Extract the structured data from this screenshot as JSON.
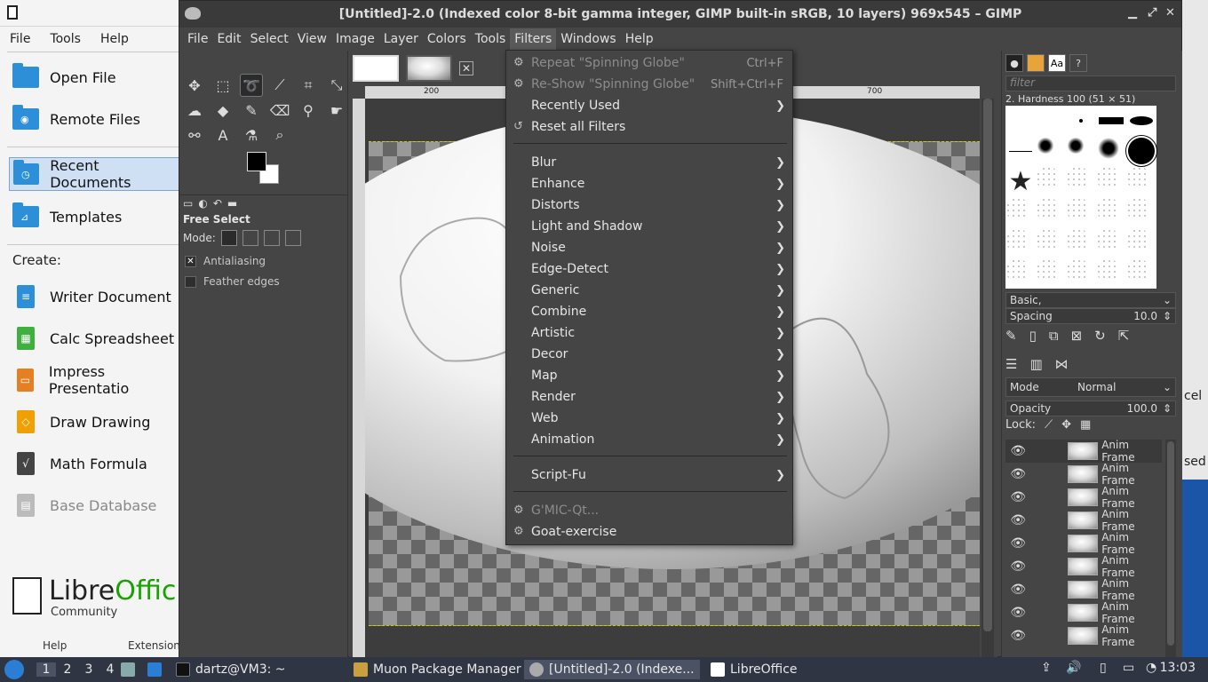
{
  "libreoffice": {
    "menu": [
      "File",
      "Tools",
      "Help"
    ],
    "nav": [
      {
        "label": "Open File",
        "icon": "open-folder-icon"
      },
      {
        "label": "Remote Files",
        "icon": "remote-folder-icon"
      },
      {
        "label": "Recent Documents",
        "icon": "recent-folder-icon"
      },
      {
        "label": "Templates",
        "icon": "templates-folder-icon"
      }
    ],
    "create_label": "Create:",
    "create": [
      {
        "label": "Writer Document",
        "color": "#2d8fd8"
      },
      {
        "label": "Calc Spreadsheet",
        "color": "#3faf3f"
      },
      {
        "label": "Impress Presentatio",
        "color": "#e67e22"
      },
      {
        "label": "Draw Drawing",
        "color": "#f0a000"
      },
      {
        "label": "Math Formula",
        "color": "#444444"
      },
      {
        "label": "Base Database",
        "color": "#aaaaaa"
      }
    ],
    "brand_a": "Libre",
    "brand_b": "Offic",
    "brand_sub": "Community",
    "footer_help": "Help",
    "footer_ext": "Extension"
  },
  "gimp": {
    "title": "[Untitled]-2.0 (Indexed color 8-bit gamma integer, GIMP built-in sRGB, 10 layers) 969x545 – GIMP",
    "menu": [
      "File",
      "Edit",
      "Select",
      "View",
      "Image",
      "Layer",
      "Colors",
      "Tools",
      "Filters",
      "Windows",
      "Help"
    ],
    "open_menu": "Filters",
    "tool_options": {
      "title": "Free Select",
      "mode_label": "Mode:",
      "antialiasing": "Antialiasing",
      "feather": "Feather edges"
    },
    "ruler": {
      "mark_200": "200",
      "mark_700": "700"
    },
    "filters_menu": {
      "top": [
        {
          "label": "Repeat \"Spinning Globe\"",
          "accel": "Ctrl+F",
          "disabled": true
        },
        {
          "label": "Re-Show \"Spinning Globe\"",
          "accel": "Shift+Ctrl+F",
          "disabled": true
        },
        {
          "label": "Recently Used",
          "submenu": true
        },
        {
          "label": "Reset all Filters"
        }
      ],
      "groups": [
        "Blur",
        "Enhance",
        "Distorts",
        "Light and Shadow",
        "Noise",
        "Edge-Detect",
        "Generic",
        "Combine",
        "Artistic",
        "Decor",
        "Map",
        "Render",
        "Web",
        "Animation"
      ],
      "script": "Script-Fu",
      "gmic": "G'MIC-Qt...",
      "goat": "Goat-exercise"
    },
    "dock": {
      "filter_placeholder": "filter",
      "brush_title": "2. Hardness 100 (51 × 51)",
      "brush_set": "Basic,",
      "spacing_label": "Spacing",
      "spacing_value": "10.0",
      "mode_label": "Mode",
      "mode_value": "Normal",
      "opacity_label": "Opacity",
      "opacity_value": "100.0",
      "lock_label": "Lock:",
      "layers": [
        "Anim Frame",
        "Anim Frame",
        "Anim Frame",
        "Anim Frame",
        "Anim Frame",
        "Anim Frame",
        "Anim Frame",
        "Anim Frame",
        "Anim Frame"
      ]
    }
  },
  "bg_window": {
    "frag1": "cel",
    "frag2": "sed"
  },
  "taskbar": {
    "workspaces": [
      "1",
      "2",
      "3",
      "4"
    ],
    "terminal": "dartz@VM3: ~",
    "muon": "Muon Package Manager",
    "gimp": "[Untitled]-2.0 (Indexe...",
    "libreoffice": "LibreOffice",
    "clock": "13:03"
  }
}
